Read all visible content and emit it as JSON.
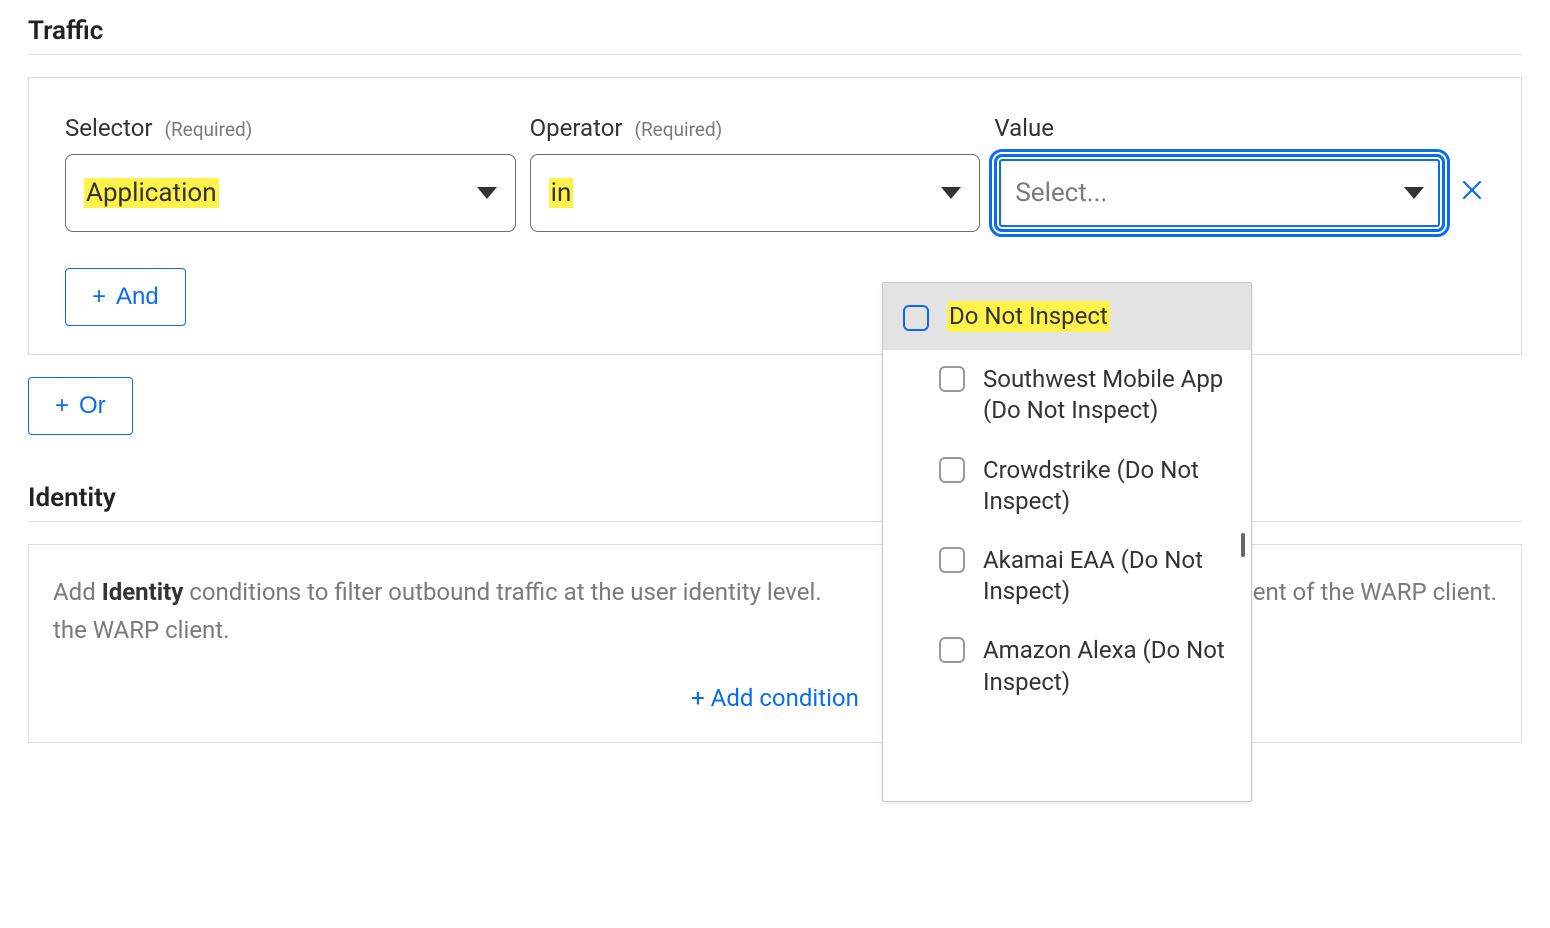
{
  "traffic": {
    "title": "Traffic",
    "fields": {
      "selector": {
        "label": "Selector",
        "required": "(Required)",
        "value": "Application"
      },
      "operator": {
        "label": "Operator",
        "required": "(Required)",
        "value": "in"
      },
      "value": {
        "label": "Value",
        "placeholder": "Select..."
      }
    },
    "and_label": "And",
    "or_label": "Or"
  },
  "dropdown": {
    "options": [
      {
        "label": "Do Not Inspect",
        "highlighted": true,
        "hovered": true
      },
      {
        "label": "Southwest Mobile App (Do Not Inspect)"
      },
      {
        "label": "Crowdstrike (Do Not Inspect)"
      },
      {
        "label": "Akamai EAA (Do Not Inspect)"
      },
      {
        "label": "Amazon Alexa (Do Not Inspect)"
      }
    ]
  },
  "identity": {
    "title": "Identity",
    "description_prefix": "Add ",
    "description_bold": "Identity",
    "description_rest": " conditions to filter outbound traffic at the user identity level.",
    "description_tail": "ment of the WARP client.",
    "add_condition": "+ Add condition"
  }
}
